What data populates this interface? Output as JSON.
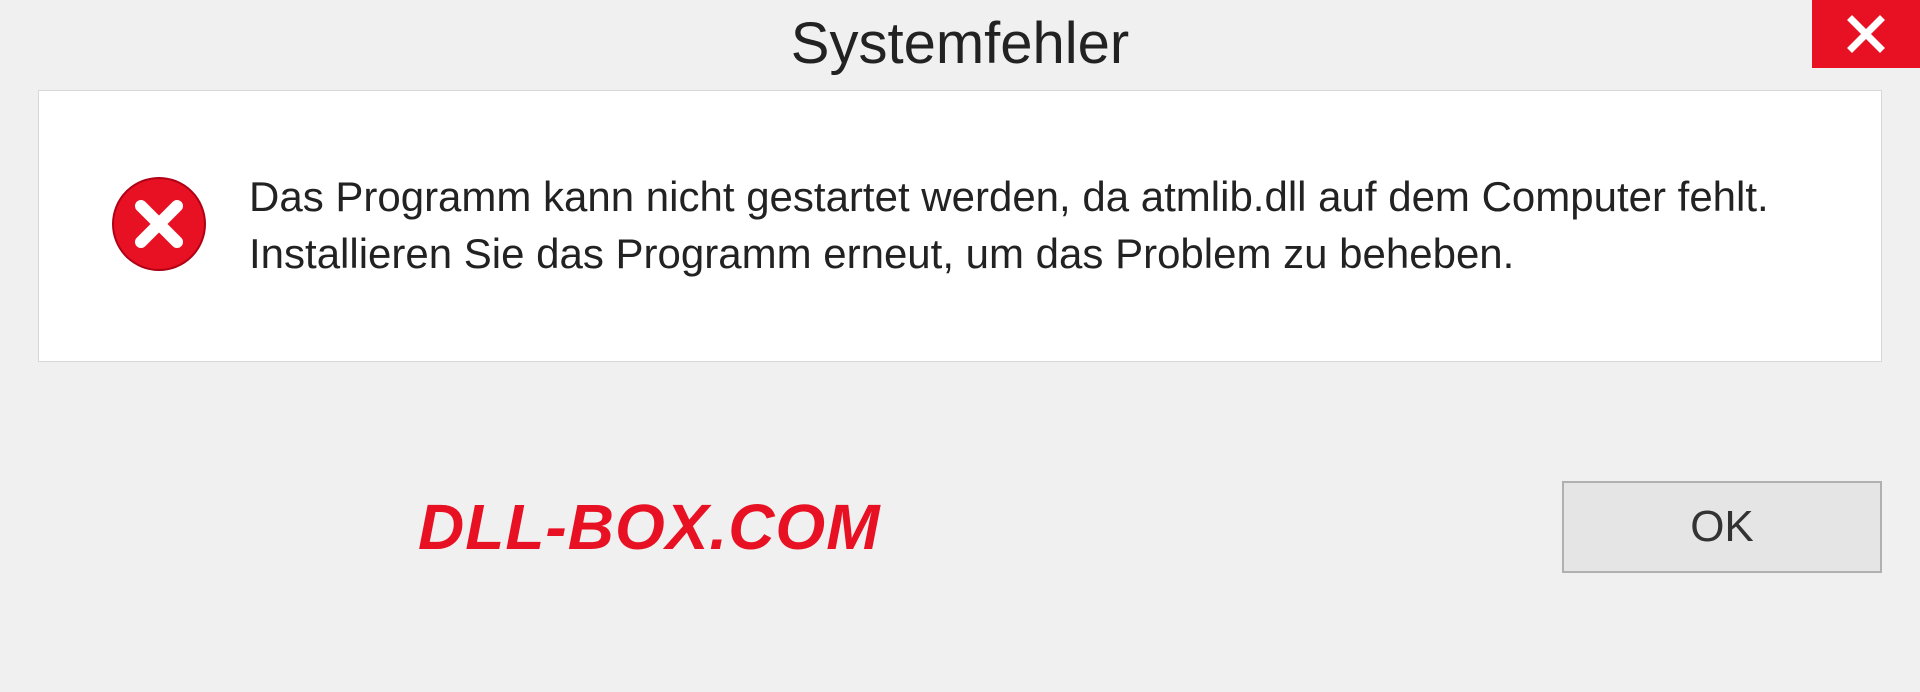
{
  "dialog": {
    "title": "Systemfehler",
    "message": "Das Programm kann nicht gestartet werden, da atmlib.dll auf dem Computer fehlt. Installieren Sie das Programm erneut, um das Problem zu beheben.",
    "ok_label": "OK"
  },
  "watermark": "DLL-BOX.COM"
}
